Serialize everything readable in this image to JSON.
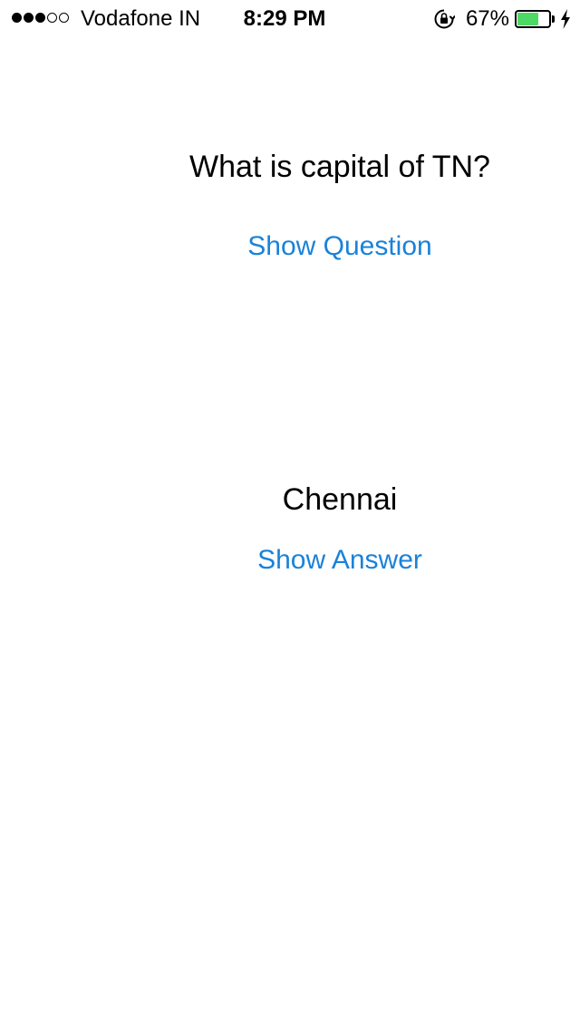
{
  "status_bar": {
    "signal": {
      "filled": 3,
      "total": 5
    },
    "carrier": "Vodafone IN",
    "time": "8:29 PM",
    "icons": [
      "orientation-lock-icon",
      "battery-icon",
      "charging-bolt-icon"
    ],
    "battery_percent": "67%",
    "battery_level": 0.67,
    "battery_color": "#4cd964"
  },
  "main": {
    "question": "What is capital of TN?",
    "show_question_label": "Show Question",
    "answer": "Chennai",
    "show_answer_label": "Show Answer",
    "accent_color": "#1a82d8"
  }
}
